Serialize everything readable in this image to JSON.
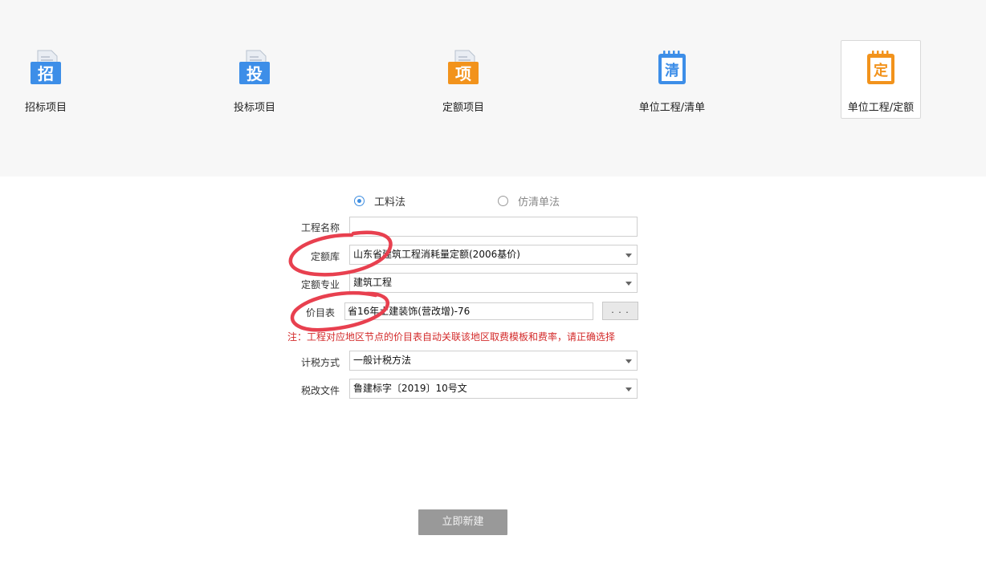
{
  "project_types": [
    {
      "label": "招标项目",
      "glyph": "招",
      "color": "#3d8ee8"
    },
    {
      "label": "投标项目",
      "glyph": "投",
      "color": "#3d8ee8"
    },
    {
      "label": "定额项目",
      "glyph": "项",
      "color": "#f2931c"
    },
    {
      "label": "单位工程/清单",
      "glyph": "清",
      "color": "#3d8ee8"
    },
    {
      "label": "单位工程/定额",
      "glyph": "定",
      "color": "#f2931c"
    }
  ],
  "selected_project_type": "单位工程/定额",
  "method": {
    "options": [
      "工料法",
      "仿清单法"
    ],
    "selected": "工料法"
  },
  "form": {
    "project_name": {
      "label": "工程名称",
      "value": ""
    },
    "quota_library": {
      "label": "定额库",
      "value": "山东省建筑工程消耗量定额(2006基价)"
    },
    "quota_major": {
      "label": "定额专业",
      "value": "建筑工程"
    },
    "price_table": {
      "label": "价目表",
      "value": "省16年土建装饰(营改增)-76",
      "browse_label": ". . ."
    },
    "note": "注：工程对应地区节点的价目表自动关联该地区取费模板和费率，请正确选择",
    "tax_method": {
      "label": "计税方式",
      "value": "一般计税方法"
    },
    "tax_reform_doc": {
      "label": "税改文件",
      "value": "鲁建标字〔2019〕10号文"
    }
  },
  "create_button_label": "立即新建",
  "colors": {
    "accent": "#3d8de0",
    "note_red": "#d32a2a",
    "annotation_red": "#e8404f",
    "disabled_button": "#999999"
  }
}
